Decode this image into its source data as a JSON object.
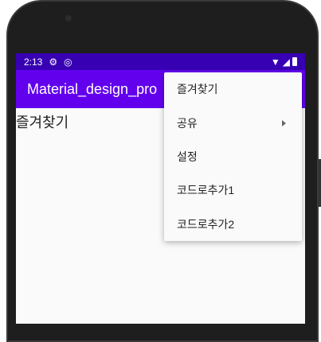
{
  "status_bar": {
    "time": "2:13"
  },
  "app_bar": {
    "title": "Material_design_pro"
  },
  "content": {
    "text": "즐겨찾기"
  },
  "menu": {
    "items": [
      {
        "label": "즐겨찾기"
      },
      {
        "label": "공유",
        "has_submenu": true
      },
      {
        "label": "설정"
      },
      {
        "label": "코드로추가1"
      },
      {
        "label": "코드로추가2"
      }
    ]
  },
  "colors": {
    "status_bar": "#3700b3",
    "app_bar": "#6200ee"
  }
}
